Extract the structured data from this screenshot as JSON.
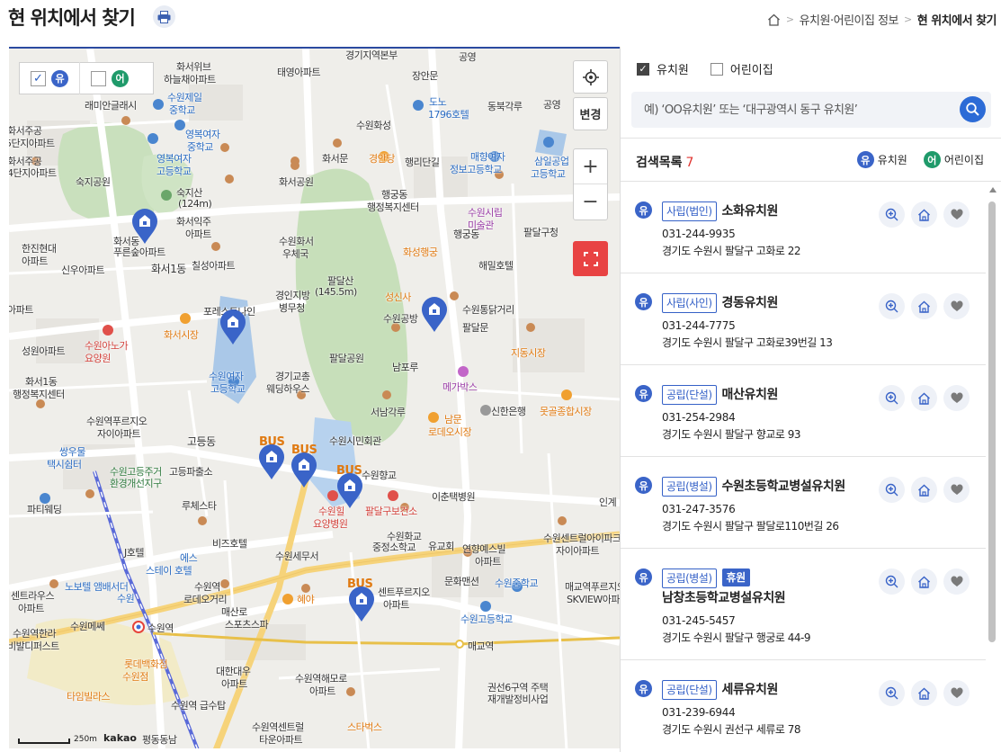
{
  "header": {
    "title": "현 위치에서 찾기",
    "breadcrumb": [
      "유치원·어린이집 정보",
      "현 위치에서 찾기"
    ]
  },
  "map": {
    "filter": {
      "kindergarten_badge": "유",
      "daycare_badge": "어"
    },
    "change_label": "변경",
    "zoom_in": "+",
    "zoom_out": "−",
    "scale_label": "250m",
    "provider": "kakao",
    "bus_label": "BUS",
    "labels": [
      {
        "text": "경기지역본부",
        "cls": ""
      },
      {
        "text": "공영",
        "cls": ""
      },
      {
        "text": "화서위브",
        "cls": ""
      },
      {
        "text": "하늘채아파트",
        "cls": ""
      },
      {
        "text": "태영아파트",
        "cls": ""
      },
      {
        "text": "장안문",
        "cls": ""
      },
      {
        "text": "수원제일",
        "cls": "blue"
      },
      {
        "text": "중학교",
        "cls": "blue"
      },
      {
        "text": "래미안글래시",
        "cls": ""
      },
      {
        "text": "도노",
        "cls": "blue"
      },
      {
        "text": "1796호텔",
        "cls": "blue"
      },
      {
        "text": "동북각루",
        "cls": ""
      },
      {
        "text": "공영",
        "cls": ""
      },
      {
        "text": "영복여자",
        "cls": "blue"
      },
      {
        "text": "중학교",
        "cls": "blue"
      },
      {
        "text": "수원화성",
        "cls": ""
      },
      {
        "text": "화서주공",
        "cls": ""
      },
      {
        "text": "5단지아파트",
        "cls": ""
      },
      {
        "text": "영복여자",
        "cls": "blue"
      },
      {
        "text": "고등학교",
        "cls": "blue"
      },
      {
        "text": "화서문",
        "cls": ""
      },
      {
        "text": "경안당",
        "cls": "orange"
      },
      {
        "text": "행리단길",
        "cls": ""
      },
      {
        "text": "매향여자",
        "cls": "blue"
      },
      {
        "text": "정보고등학교",
        "cls": "blue"
      },
      {
        "text": "삼일공업",
        "cls": "blue"
      },
      {
        "text": "고등학교",
        "cls": "blue"
      },
      {
        "text": "화서주공",
        "cls": ""
      },
      {
        "text": "4단지아파트",
        "cls": ""
      },
      {
        "text": "숙지공원",
        "cls": ""
      },
      {
        "text": "화서공원",
        "cls": ""
      },
      {
        "text": "숙지산",
        "cls": ""
      },
      {
        "text": "(124m)",
        "cls": ""
      },
      {
        "text": "행궁동",
        "cls": ""
      },
      {
        "text": "행정복지센터",
        "cls": ""
      },
      {
        "text": "수원시립",
        "cls": "purple"
      },
      {
        "text": "미술관",
        "cls": "purple"
      },
      {
        "text": "행궁동",
        "cls": ""
      },
      {
        "text": "팔달구청",
        "cls": ""
      },
      {
        "text": "화서익주",
        "cls": ""
      },
      {
        "text": "아파트",
        "cls": ""
      },
      {
        "text": "수원화서",
        "cls": ""
      },
      {
        "text": "우체국",
        "cls": ""
      },
      {
        "text": "한진현대",
        "cls": ""
      },
      {
        "text": "아파트",
        "cls": ""
      },
      {
        "text": "화서동",
        "cls": ""
      },
      {
        "text": "푸른숲아파트",
        "cls": ""
      },
      {
        "text": "화성행궁",
        "cls": "orange"
      },
      {
        "text": "신우아파트",
        "cls": ""
      },
      {
        "text": "화서1동",
        "cls": "big"
      },
      {
        "text": "칠성아파트",
        "cls": ""
      },
      {
        "text": "팔달산",
        "cls": ""
      },
      {
        "text": "(145.5m)",
        "cls": ""
      },
      {
        "text": "해밀호텔",
        "cls": ""
      },
      {
        "text": "경인지방",
        "cls": ""
      },
      {
        "text": "병무청",
        "cls": ""
      },
      {
        "text": "성신사",
        "cls": "orange"
      },
      {
        "text": "수원통닭거리",
        "cls": ""
      },
      {
        "text": "포레스트나인",
        "cls": ""
      },
      {
        "text": "수원공방",
        "cls": ""
      },
      {
        "text": "아파트",
        "cls": ""
      },
      {
        "text": "화서시장",
        "cls": "orange"
      },
      {
        "text": "팔달문",
        "cls": ""
      },
      {
        "text": "수원아노가",
        "cls": "red"
      },
      {
        "text": "요양원",
        "cls": "red"
      },
      {
        "text": "팔달공원",
        "cls": ""
      },
      {
        "text": "지동시장",
        "cls": "orange"
      },
      {
        "text": "성원아파트",
        "cls": ""
      },
      {
        "text": "남포루",
        "cls": ""
      },
      {
        "text": "수원여자",
        "cls": "blue"
      },
      {
        "text": "고등학교",
        "cls": "blue"
      },
      {
        "text": "경기교총",
        "cls": ""
      },
      {
        "text": "웨딩하우스",
        "cls": ""
      },
      {
        "text": "메가박스",
        "cls": "purple"
      },
      {
        "text": "화서1동",
        "cls": ""
      },
      {
        "text": "행정복지센터",
        "cls": ""
      },
      {
        "text": "신한은행",
        "cls": ""
      },
      {
        "text": "못골종합시장",
        "cls": "orange"
      },
      {
        "text": "서남각루",
        "cls": ""
      },
      {
        "text": "남문",
        "cls": "orange"
      },
      {
        "text": "로데오시장",
        "cls": "orange"
      },
      {
        "text": "수원역푸르지오",
        "cls": ""
      },
      {
        "text": "자이아파트",
        "cls": ""
      },
      {
        "text": "고등동",
        "cls": "big"
      },
      {
        "text": "수원시민회관",
        "cls": ""
      },
      {
        "text": "쌍우물",
        "cls": "blue"
      },
      {
        "text": "택시쉼터",
        "cls": "blue"
      },
      {
        "text": "수원고등주거",
        "cls": "green"
      },
      {
        "text": "환경개선지구",
        "cls": "green"
      },
      {
        "text": "고등파출소",
        "cls": ""
      },
      {
        "text": "수원향교",
        "cls": ""
      },
      {
        "text": "루체스타",
        "cls": ""
      },
      {
        "text": "이춘택병원",
        "cls": ""
      },
      {
        "text": "파티웨딩",
        "cls": ""
      },
      {
        "text": "수원힐",
        "cls": "red"
      },
      {
        "text": "요양병원",
        "cls": "red"
      },
      {
        "text": "팔달구보건소",
        "cls": "red"
      },
      {
        "text": "수원센트럴아이파크",
        "cls": ""
      },
      {
        "text": "자이아파트",
        "cls": ""
      },
      {
        "text": "비즈호텔",
        "cls": ""
      },
      {
        "text": "수원화교",
        "cls": ""
      },
      {
        "text": "중정소학교",
        "cls": ""
      },
      {
        "text": "유교회",
        "cls": ""
      },
      {
        "text": "연향예스빌",
        "cls": ""
      },
      {
        "text": "아파트",
        "cls": ""
      },
      {
        "text": "J호텔",
        "cls": ""
      },
      {
        "text": "에스",
        "cls": "blue"
      },
      {
        "text": "스테이 호텔",
        "cls": "blue"
      },
      {
        "text": "수원세무서",
        "cls": ""
      },
      {
        "text": "문화맨션",
        "cls": ""
      },
      {
        "text": "수원중학교",
        "cls": "blue"
      },
      {
        "text": "매교역푸르지오",
        "cls": ""
      },
      {
        "text": "SKVIEW아파트",
        "cls": ""
      },
      {
        "text": "노보텔 앰배서더",
        "cls": "blue"
      },
      {
        "text": "수원",
        "cls": "blue"
      },
      {
        "text": "수원역",
        "cls": ""
      },
      {
        "text": "로데오거리",
        "cls": ""
      },
      {
        "text": "혜야",
        "cls": "orange"
      },
      {
        "text": "센트라우스",
        "cls": ""
      },
      {
        "text": "아파트",
        "cls": ""
      },
      {
        "text": "매산로",
        "cls": ""
      },
      {
        "text": "스포츠스파",
        "cls": ""
      },
      {
        "text": "센트푸르지오",
        "cls": ""
      },
      {
        "text": "아파트",
        "cls": ""
      },
      {
        "text": "수원고등학교",
        "cls": "blue"
      },
      {
        "text": "수원메쎄",
        "cls": ""
      },
      {
        "text": "수원역",
        "cls": ""
      },
      {
        "text": "수원역한라",
        "cls": ""
      },
      {
        "text": "비발디퍼스트",
        "cls": ""
      },
      {
        "text": "매교역",
        "cls": ""
      },
      {
        "text": "롯데백화점",
        "cls": "orange"
      },
      {
        "text": "수원점",
        "cls": "orange"
      },
      {
        "text": "대한대우",
        "cls": ""
      },
      {
        "text": "아파트",
        "cls": ""
      },
      {
        "text": "수원역해모로",
        "cls": ""
      },
      {
        "text": "아파트",
        "cls": ""
      },
      {
        "text": "권선6구역 주택",
        "cls": ""
      },
      {
        "text": "재개발정비사업",
        "cls": ""
      },
      {
        "text": "타임빌라스",
        "cls": "orange"
      },
      {
        "text": "수원역 급수탑",
        "cls": ""
      },
      {
        "text": "수원역센트럴",
        "cls": ""
      },
      {
        "text": "타운아파트",
        "cls": ""
      },
      {
        "text": "스타벅스",
        "cls": "orange"
      },
      {
        "text": "평동동남",
        "cls": ""
      },
      {
        "text": "인계",
        "cls": ""
      }
    ]
  },
  "panel": {
    "filters": [
      {
        "label": "유치원",
        "checked": true
      },
      {
        "label": "어린이집",
        "checked": false
      }
    ],
    "search": {
      "placeholder": "예) ‘OO유치원’ 또는 ‘대구광역시 동구 유치원’"
    },
    "results": {
      "label": "검색목록",
      "count": "7",
      "legend_kindergarten": "유치원",
      "legend_daycare": "어린이집"
    },
    "items": [
      {
        "badge": "유",
        "type": "사립(법인)",
        "status": "",
        "name": "소화유치원",
        "phone": "031-244-9935",
        "address": "경기도 수원시 팔달구 고화로 22"
      },
      {
        "badge": "유",
        "type": "사립(사인)",
        "status": "",
        "name": "경동유치원",
        "phone": "031-244-7775",
        "address": "경기도 수원시 팔달구 고화로39번길 13"
      },
      {
        "badge": "유",
        "type": "공립(단설)",
        "status": "",
        "name": "매산유치원",
        "phone": "031-254-2984",
        "address": "경기도 수원시 팔달구 향교로 93"
      },
      {
        "badge": "유",
        "type": "공립(병설)",
        "status": "",
        "name": "수원초등학교병설유치원",
        "phone": "031-247-3576",
        "address": "경기도 수원시 팔달구 팔달로110번길 26"
      },
      {
        "badge": "유",
        "type": "공립(병설)",
        "status": "휴원",
        "name": "남창초등학교병설유치원",
        "phone": "031-245-5457",
        "address": "경기도 수원시 팔달구 행궁로 44-9"
      },
      {
        "badge": "유",
        "type": "공립(단설)",
        "status": "",
        "name": "세류유치원",
        "phone": "031-239-6944",
        "address": "경기도 수원시 권선구 세류로 78"
      }
    ]
  },
  "colors": {
    "accent": "#2c6bd6",
    "kindergarten": "#3a64c8",
    "daycare": "#1f9a6a",
    "count": "#e0332f",
    "fullscreen": "#e84343"
  }
}
